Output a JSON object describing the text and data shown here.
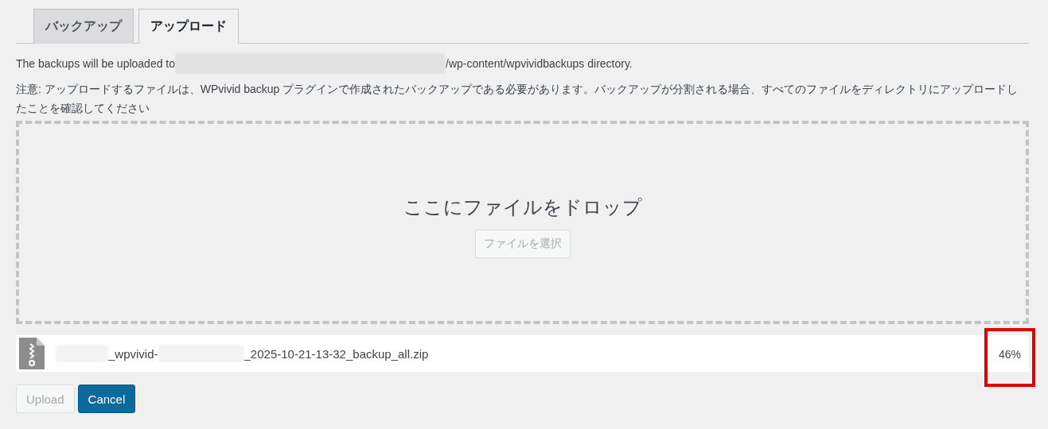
{
  "tabs": [
    {
      "label": "バックアップ",
      "selected": false
    },
    {
      "label": "アップロード",
      "selected": true
    }
  ],
  "destination": {
    "before": "The backups will be uploaded to",
    "after": "/wp-content/wpvividbackups directory."
  },
  "notice": "注意: アップロードするファイルは、WPvivid backup プラグインで作成されたバックアップである必要があります。バックアップが分割される場合、すべてのファイルをディレクトリにアップロードしたことを確認してください",
  "dropzone": {
    "heading": "ここにファイルをドロップ",
    "button": "ファイルを選択"
  },
  "file": {
    "name_parts": [
      "_wpvivid-",
      "_2025-10-21-13-32_backup_all.zip"
    ],
    "progress": "46%",
    "highlighted": true
  },
  "buttons": [
    {
      "label": "Upload",
      "kind": "secondary",
      "disabled": true
    },
    {
      "label": "Cancel",
      "kind": "primary",
      "disabled": false
    }
  ]
}
